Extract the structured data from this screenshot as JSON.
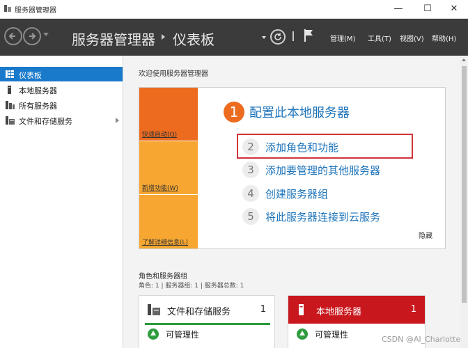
{
  "window": {
    "title": "服务器管理器",
    "controls": {
      "minimize": "—",
      "maximize": "☐",
      "close": "✕"
    }
  },
  "header": {
    "app_name": "服务器管理器",
    "page_name": "仪表板",
    "menus": [
      {
        "label": "管理(M)"
      },
      {
        "label": "工具(T)"
      },
      {
        "label": "视图(V)"
      },
      {
        "label": "帮助(H)"
      }
    ]
  },
  "sidebar": {
    "items": [
      {
        "label": "仪表板",
        "icon": "dashboard-icon",
        "active": true
      },
      {
        "label": "本地服务器",
        "icon": "server-icon"
      },
      {
        "label": "所有服务器",
        "icon": "servers-icon"
      },
      {
        "label": "文件和存储服务",
        "icon": "storage-icon",
        "has_submenu": true
      }
    ]
  },
  "main": {
    "welcome_title": "欢迎使用服务器管理器",
    "tiles": [
      {
        "label": "快速启动(Q)",
        "color": "#ec6b1f"
      },
      {
        "label": "新增功能(W)",
        "color": "#f7a731"
      },
      {
        "label": "了解详细信息(L)",
        "color": "#f7a731"
      }
    ],
    "steps": [
      {
        "number": "1",
        "label": "配置此本地服务器"
      },
      {
        "number": "2",
        "label": "添加角色和功能"
      },
      {
        "number": "3",
        "label": "添加要管理的其他服务器"
      },
      {
        "number": "4",
        "label": "创建服务器组"
      },
      {
        "number": "5",
        "label": "将此服务器连接到云服务"
      }
    ],
    "hide_label": "隐藏",
    "roles_section": {
      "title": "角色和服务器组",
      "summary": "角色: 1 | 服务器组: 1 | 服务器总数: 1",
      "tiles": [
        {
          "name": "文件和存储服务",
          "count": "1",
          "status": "可管理性",
          "header_color": "#ffffff"
        },
        {
          "name": "本地服务器",
          "count": "1",
          "status": "可管理性",
          "header_color": "#c8171d"
        }
      ]
    }
  },
  "colors": {
    "accent": "#1979ca",
    "header_bg": "#3b3b3b",
    "highlight_border": "#d1343a",
    "ok_green": "#2e9c3f"
  },
  "watermark": "CSDN @AI_Charlotte"
}
